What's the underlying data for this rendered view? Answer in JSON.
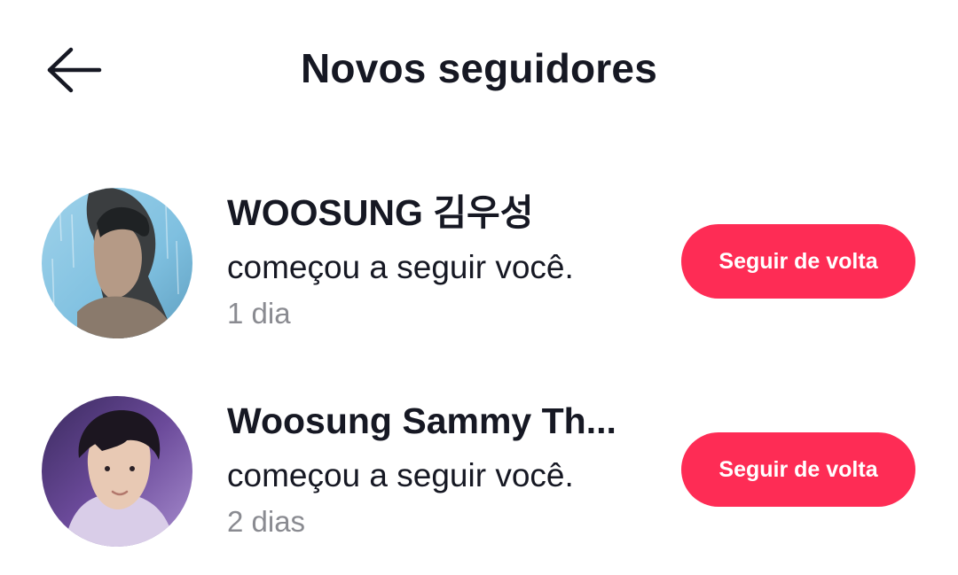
{
  "header": {
    "title": "Novos seguidores",
    "back_icon": "arrow-left-icon"
  },
  "followers": [
    {
      "name": "WOOSUNG 김우성",
      "action": "começou a seguir você.",
      "time": "1 dia",
      "button_label": "Seguir de volta"
    },
    {
      "name": "Woosung Sammy Th...",
      "action": "começou a seguir você.",
      "time": "2 dias",
      "button_label": "Seguir de volta"
    }
  ],
  "colors": {
    "accent": "#fe2c55",
    "text_primary": "#161823",
    "text_secondary": "#8a8b91",
    "background": "#ffffff"
  }
}
